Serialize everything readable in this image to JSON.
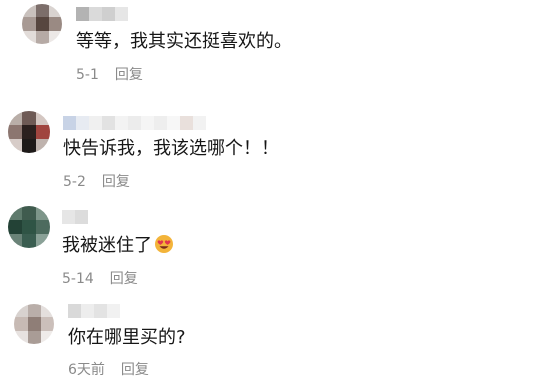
{
  "comments": [
    {
      "text": "等等，我其实还挺喜欢的。",
      "date": "5-1",
      "reply": "回复"
    },
    {
      "text": "快告诉我，我该选哪个！！",
      "date": "5-2",
      "reply": "回复"
    },
    {
      "text": "我被迷住了",
      "date": "5-14",
      "reply": "回复",
      "emoji": "heart-eyes-emoji"
    },
    {
      "text": "你在哪里买的?",
      "date": "6天前",
      "reply": "回复"
    }
  ]
}
